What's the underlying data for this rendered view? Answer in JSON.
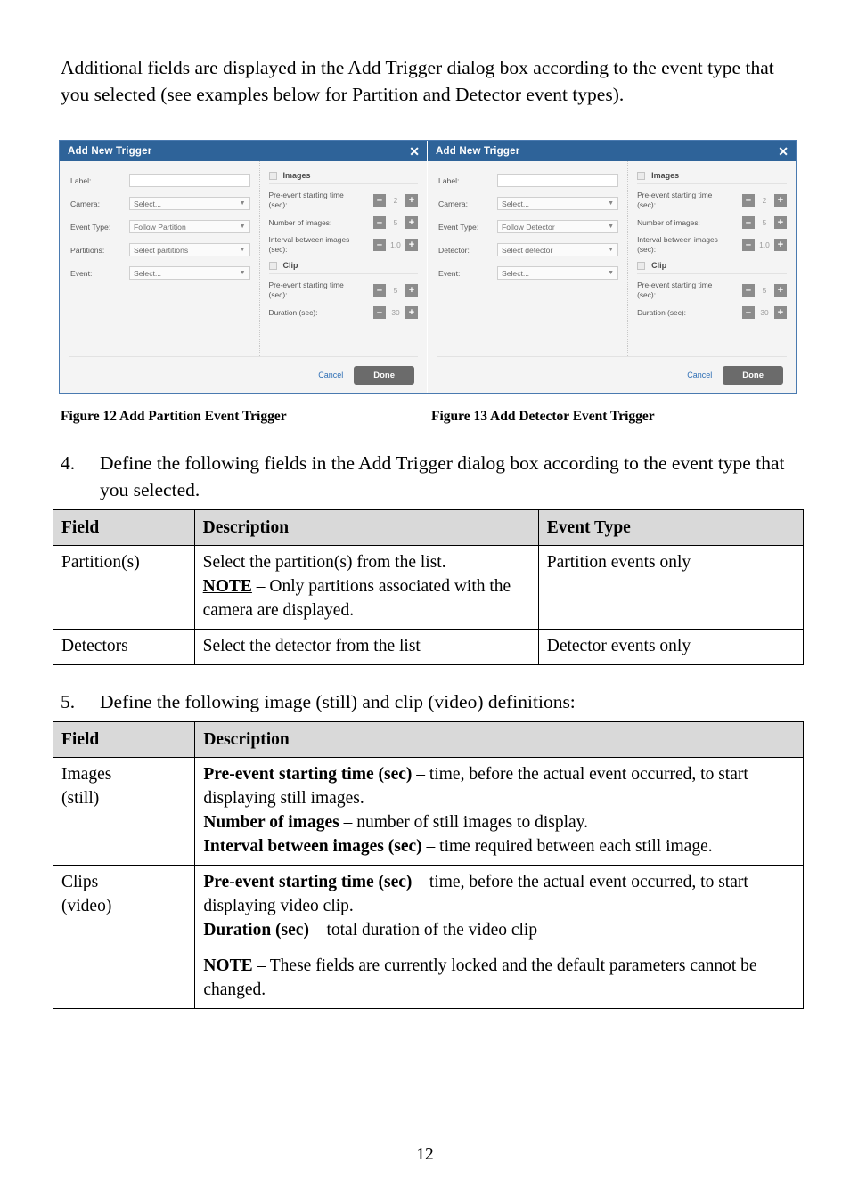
{
  "intro": {
    "paragraph": "Additional fields are displayed in the Add Trigger dialog box according to the event type that you selected (see examples below for Partition and Detector event types)."
  },
  "figures": {
    "partition_dialog": {
      "title": "Add New Trigger",
      "close_label": "✕",
      "form": [
        {
          "label": "Label:",
          "value": "",
          "type": "text"
        },
        {
          "label": "Camera:",
          "value": "Select...",
          "type": "select"
        },
        {
          "label": "Event Type:",
          "value": "Follow Partition",
          "type": "select"
        },
        {
          "label": "Partitions:",
          "value": "Select partitions",
          "type": "select"
        },
        {
          "label": "Event:",
          "value": "Select...",
          "type": "select"
        }
      ],
      "images_section": {
        "checkbox_label": "Images",
        "rows": [
          {
            "label": "Pre-event starting time (sec):",
            "value": "2",
            "minus": "–",
            "plus": "+"
          },
          {
            "label": "Number of images:",
            "value": "5",
            "minus": "–",
            "plus": "+"
          },
          {
            "label": "Interval between images (sec):",
            "value": "1.0",
            "minus": "–",
            "plus": "+"
          }
        ]
      },
      "clip_section": {
        "checkbox_label": "Clip",
        "rows": [
          {
            "label": "Pre-event starting time (sec):",
            "value": "5",
            "minus": "–",
            "plus": "+"
          },
          {
            "label": "Duration (sec):",
            "value": "30",
            "minus": "–",
            "plus": "+"
          }
        ]
      },
      "footer": {
        "cancel": "Cancel",
        "done": "Done"
      }
    },
    "detector_dialog": {
      "title": "Add New Trigger",
      "close_label": "✕",
      "form": [
        {
          "label": "Label:",
          "value": "",
          "type": "text"
        },
        {
          "label": "Camera:",
          "value": "Select...",
          "type": "select"
        },
        {
          "label": "Event Type:",
          "value": "Follow Detector",
          "type": "select"
        },
        {
          "label": "Detector:",
          "value": "Select detector",
          "type": "select"
        },
        {
          "label": "Event:",
          "value": "Select...",
          "type": "select"
        }
      ],
      "images_section": {
        "checkbox_label": "Images",
        "rows": [
          {
            "label": "Pre-event starting time (sec):",
            "value": "2",
            "minus": "–",
            "plus": "+"
          },
          {
            "label": "Number of images:",
            "value": "5",
            "minus": "–",
            "plus": "+"
          },
          {
            "label": "Interval between images (sec):",
            "value": "1.0",
            "minus": "–",
            "plus": "+"
          }
        ]
      },
      "clip_section": {
        "checkbox_label": "Clip",
        "rows": [
          {
            "label": "Pre-event starting time (sec):",
            "value": "5",
            "minus": "–",
            "plus": "+"
          },
          {
            "label": "Duration (sec):",
            "value": "30",
            "minus": "–",
            "plus": "+"
          }
        ]
      },
      "footer": {
        "cancel": "Cancel",
        "done": "Done"
      }
    },
    "caption_12": "Figure 12 Add Partition Event Trigger",
    "caption_13": "Figure 13 Add Detector Event Trigger"
  },
  "steps": {
    "step4": {
      "number": "4.",
      "text": "Define the following fields in the Add Trigger dialog box according to the event type that you selected."
    },
    "step5": {
      "number": "5.",
      "text": "Define the following image (still) and clip (video) definitions:"
    }
  },
  "table_fields": {
    "headers": [
      "Field",
      "Description",
      "Event Type"
    ],
    "rows": [
      {
        "field": "Partition(s)",
        "desc_line1": "Select the partition(s) from the list.",
        "desc_note_label": "NOTE",
        "desc_note_text": " – Only partitions associated with the camera are displayed.",
        "event_type": "Partition events only"
      },
      {
        "field": "Detectors",
        "desc_line1": "Select the detector from the list",
        "event_type": "Detector events only"
      }
    ]
  },
  "table_media": {
    "headers": [
      "Field",
      "Description"
    ],
    "rows": [
      {
        "field_line1": "Images",
        "field_line2": "(still)",
        "items": [
          {
            "term": "Pre-event starting time (sec)",
            "def": " – time, before the actual event occurred, to start displaying still images."
          },
          {
            "term": "Number of images",
            "def": " – number of still images to display."
          },
          {
            "term": "Interval between images (sec)",
            "def": " – time required between each still image."
          }
        ]
      },
      {
        "field_line1": "Clips",
        "field_line2": "(video)",
        "items": [
          {
            "term": "Pre-event starting time (sec)",
            "def": " – time, before the actual event occurred, to start displaying video clip."
          },
          {
            "term": "Duration (sec)",
            "def": " – total duration of the video clip"
          }
        ],
        "note_term": "NOTE",
        "note_def": " – These fields are currently locked and the default parameters cannot be changed."
      }
    ]
  },
  "footer": {
    "page_number": "12"
  },
  "colors": {
    "titlebar_blue": "#2e6399",
    "done_button_gray": "#6b6b6b",
    "cancel_link_blue": "#2f6fb5",
    "table_header_gray": "#d9d9d9"
  }
}
